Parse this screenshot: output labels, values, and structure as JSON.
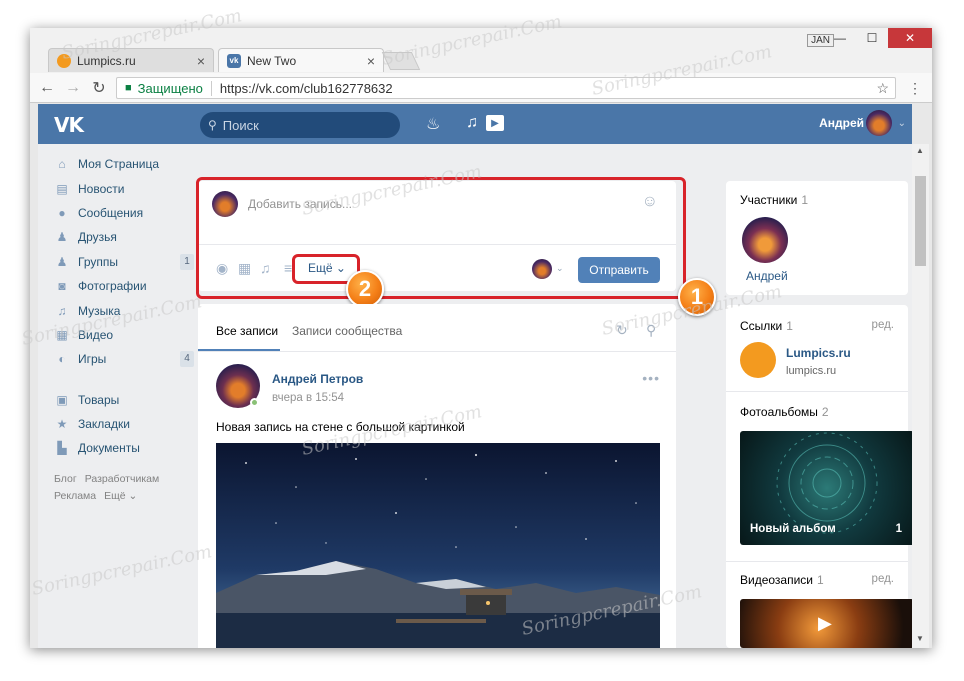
{
  "browser": {
    "tabs": [
      {
        "label": "Lumpics.ru",
        "close": "×"
      },
      {
        "label": "New Two",
        "close": "×"
      }
    ],
    "user_badge": "JAN",
    "window_buttons": {
      "minimize": "—",
      "maximize": "☐",
      "close": "✕"
    },
    "nav": {
      "back": "←",
      "forward": "→",
      "reload": "↻"
    },
    "secure_label": "Защищено",
    "url": "https://vk.com/club162778632",
    "star": "☆",
    "menu": "⋮"
  },
  "vk_header": {
    "logo": "VK",
    "search_placeholder": "Поиск",
    "user_name": "Андрей",
    "caret": "⌄"
  },
  "left_nav": {
    "items": [
      {
        "label": "Моя Страница",
        "icon": "home-icon",
        "glyph": "⌂"
      },
      {
        "label": "Новости",
        "icon": "news-icon",
        "glyph": "▤"
      },
      {
        "label": "Сообщения",
        "icon": "messages-icon",
        "glyph": "●"
      },
      {
        "label": "Друзья",
        "icon": "friend-icon",
        "glyph": "♟"
      },
      {
        "label": "Группы",
        "icon": "groups-icon",
        "glyph": "♟",
        "badge": "1"
      },
      {
        "label": "Фотографии",
        "icon": "camera-icon",
        "glyph": "◙"
      },
      {
        "label": "Музыка",
        "icon": "music-icon",
        "glyph": "♫"
      },
      {
        "label": "Видео",
        "icon": "video-icon",
        "glyph": "▦"
      },
      {
        "label": "Игры",
        "icon": "games-icon",
        "glyph": "◐",
        "badge": "4"
      },
      {
        "label": "Товары",
        "icon": "shopping-bag-icon",
        "glyph": "▣"
      },
      {
        "label": "Закладки",
        "icon": "star-icon",
        "glyph": "★"
      },
      {
        "label": "Документы",
        "icon": "document-icon",
        "glyph": "▙"
      }
    ],
    "footer": [
      "Блог",
      "Разработчикам",
      "Реклама",
      "Ещё ⌄"
    ]
  },
  "composer": {
    "placeholder": "Добавить запись...",
    "more_label": "Ещё ⌄",
    "send_label": "Отправить"
  },
  "annotations": [
    "1",
    "2"
  ],
  "wall": {
    "tabs": [
      "Все записи",
      "Записи сообщества"
    ],
    "post": {
      "author": "Андрей Петров",
      "time": "вчера в 15:54",
      "text": "Новая запись на стене с большой картинкой",
      "menu": "•••"
    }
  },
  "right_col": {
    "members": {
      "title": "Участники",
      "count": "1",
      "name": "Андрей"
    },
    "links": {
      "title": "Ссылки",
      "count": "1",
      "edit": "ред.",
      "name": "Lumpics.ru",
      "url": "lumpics.ru"
    },
    "albums": {
      "title": "Фотоальбомы",
      "count": "2",
      "album_name": "Новый альбом",
      "album_count": "1"
    },
    "videos": {
      "title": "Видеозаписи",
      "count": "1",
      "edit": "ред."
    }
  },
  "watermark": "Soringpcrepair.Com",
  "colors": {
    "vk_blue": "#4a76a8",
    "button_blue": "#5181b8",
    "highlight_red": "#d8232a",
    "badge_orange": "#f47f17"
  }
}
